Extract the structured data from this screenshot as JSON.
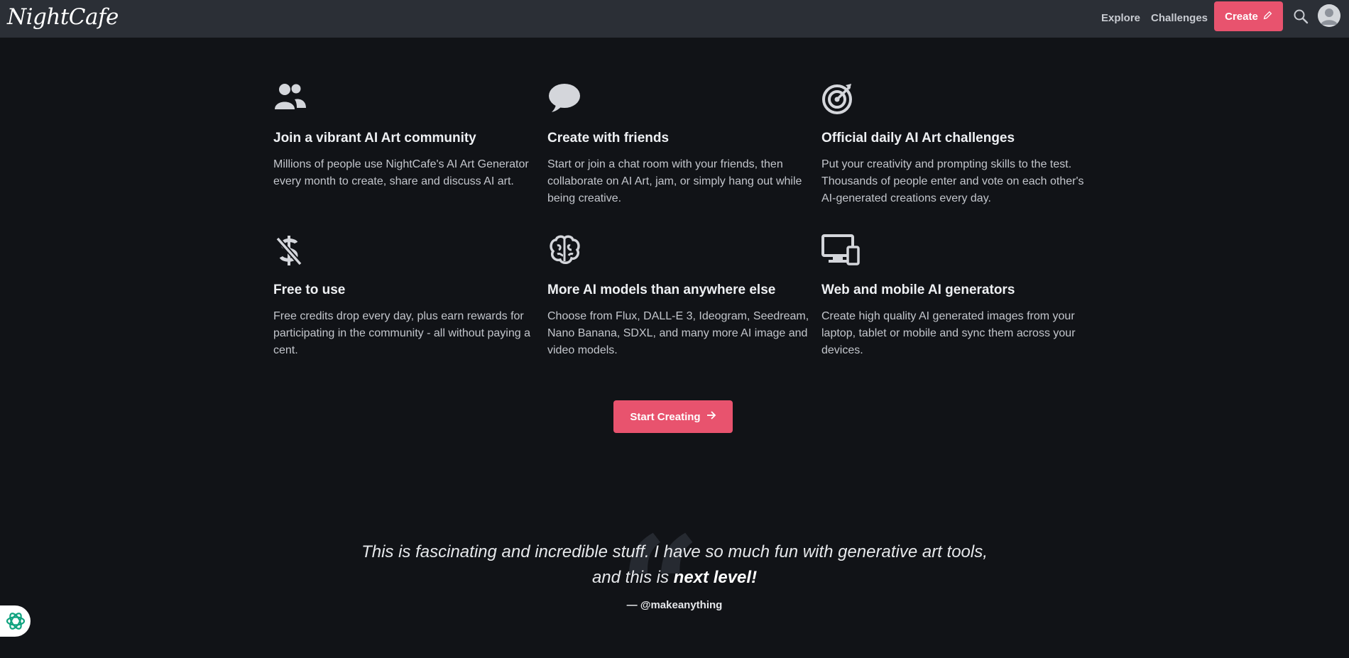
{
  "nav": {
    "logo": "NightCafe",
    "explore": "Explore",
    "challenges": "Challenges",
    "create": "Create",
    "create_icon": "pencil-icon",
    "search_icon": "search-icon",
    "avatar_icon": "user-avatar-icon"
  },
  "features": [
    {
      "icon": "users-icon",
      "title": "Join a vibrant AI Art community",
      "text": "Millions of people use NightCafe's AI Art Generator every month to create, share and discuss AI art."
    },
    {
      "icon": "chat-bubble-icon",
      "title": "Create with friends",
      "text": "Start or join a chat room with your friends, then collaborate on AI Art, jam, or simply hang out while being creative."
    },
    {
      "icon": "target-icon",
      "title": "Official daily AI Art challenges",
      "text": "Put your creativity and prompting skills to the test. Thousands of people enter and vote on each other's AI-generated creations every day."
    },
    {
      "icon": "no-dollar-icon",
      "title": "Free to use",
      "text": "Free credits drop every day, plus earn rewards for participating in the community - all without paying a cent."
    },
    {
      "icon": "brain-icon",
      "title": "More AI models than anywhere else",
      "text": "Choose from Flux, DALL-E 3, Ideogram, Seedream, Nano Banana, SDXL, and many more AI image and video models."
    },
    {
      "icon": "devices-icon",
      "title": "Web and mobile AI generators",
      "text": "Create high quality AI generated images from your laptop, tablet or mobile and sync them across your devices."
    }
  ],
  "cta": {
    "label": "Start Creating",
    "icon": "arrow-right-icon"
  },
  "testimonial": {
    "quote_mark": "“",
    "line1": "This is fascinating and incredible stuff. I have so much fun with generative art tools,",
    "line2_prefix": "and this is ",
    "line2_emphasis": "next level!",
    "author": "— @makeanything"
  },
  "chat_widget": {
    "icon": "chatgpt-icon"
  },
  "colors": {
    "background": "#111317",
    "topbar": "#2b2f36",
    "accent": "#e8536e"
  }
}
